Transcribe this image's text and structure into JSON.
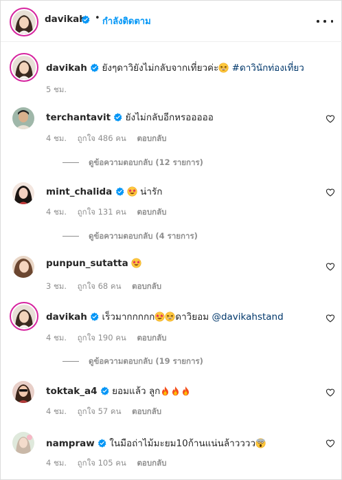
{
  "header": {
    "username": "davikah",
    "separator": "•",
    "follow_label": "กำลังติดตาม",
    "more_icon": "more-horizontal-icon"
  },
  "caption": {
    "username": "davikah",
    "text": "ยังๆดาวิยังไม่กลับจากเที่ยวค่ะ",
    "hashtag": "#ดาวินักท่องเที่ยว",
    "time": "5 ชม."
  },
  "labels": {
    "like_prefix": "ถูกใจ",
    "like_suffix": "คน",
    "reply": "ตอบกลับ"
  },
  "comments": [
    {
      "username": "terchantavit",
      "verified": true,
      "text": "ยังไม่กลับอีกหรอออออ",
      "time": "4 ชม.",
      "likes": "486",
      "replies_label": "ดูข้อความตอบกลับ (12 รายการ)"
    },
    {
      "username": "mint_chalida",
      "verified": true,
      "text": "น่ารัก",
      "time": "4 ชม.",
      "likes": "131",
      "replies_label": "ดูข้อความตอบกลับ (4 รายการ)"
    },
    {
      "username": "punpun_sutatta",
      "verified": false,
      "text": "",
      "time": "3 ชม.",
      "likes": "68",
      "replies_label": ""
    },
    {
      "username": "davikah",
      "verified": true,
      "text_before": "เร็วมากกกกก",
      "text_mid": "ดาวิยอม",
      "mention": "@davikahstand",
      "time": "4 ชม.",
      "likes": "190",
      "replies_label": "ดูข้อความตอบกลับ (19 รายการ)"
    },
    {
      "username": "toktak_a4",
      "verified": true,
      "text": "ยอมแล้ว ลูก",
      "time": "4 ชม.",
      "likes": "57",
      "replies_label": ""
    },
    {
      "username": "nampraw",
      "verified": true,
      "text": "ในมือถ่าไม้มะยม10ก้านแน่นล้าวววว",
      "time": "4 ชม.",
      "likes": "105",
      "replies_label": ""
    }
  ],
  "colors": {
    "accent": "#0095f6",
    "verified": "#0095f6",
    "muted": "#8e8e8e",
    "text": "#262626",
    "story_ring": "#d6249f"
  }
}
